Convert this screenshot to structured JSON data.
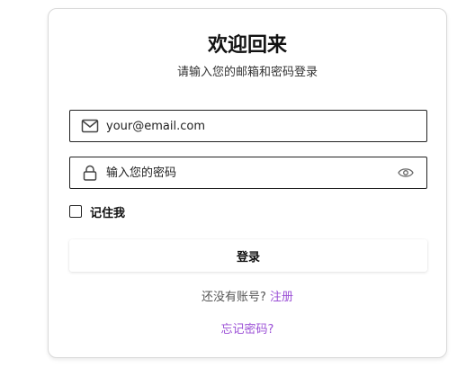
{
  "login": {
    "title": "欢迎回来",
    "subtitle": "请输入您的邮箱和密码登录",
    "email": {
      "icon": "mail-icon",
      "value": "",
      "placeholder": "your@email.com"
    },
    "password": {
      "icon": "lock-icon",
      "value": "",
      "placeholder": "输入您的密码",
      "toggle_icon": "eye-icon"
    },
    "remember_label": "记住我",
    "remember_checked": false,
    "submit_label": "登录",
    "signup_prompt": "还没有账号?",
    "signup_link": "注册",
    "forgot_link": "忘记密码?"
  },
  "colors": {
    "link": "#9b4fd6",
    "border": "#222222",
    "text": "#111111"
  }
}
